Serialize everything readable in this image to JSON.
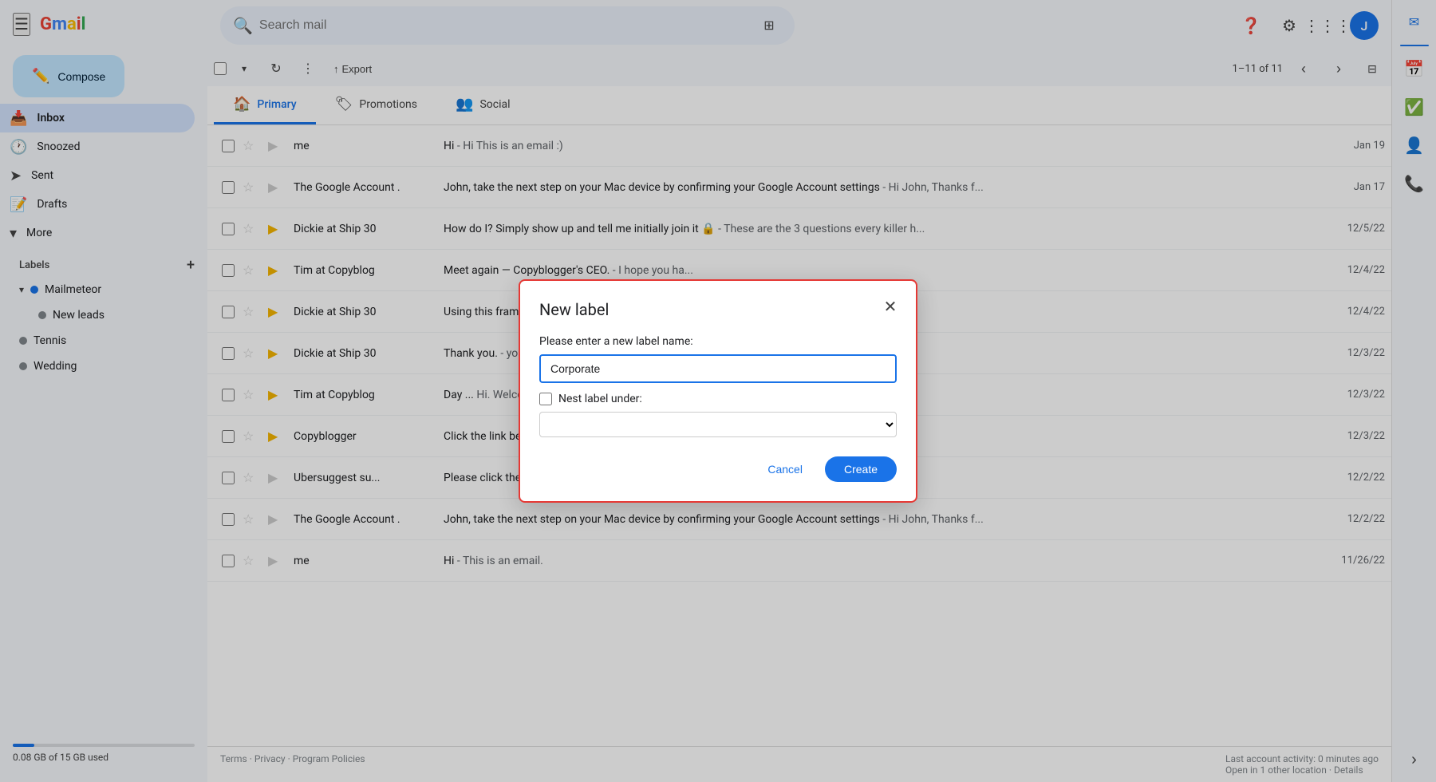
{
  "sidebar": {
    "hamburger_label": "☰",
    "logo_letters": [
      "G",
      "m",
      "a",
      "i",
      "l"
    ],
    "logo_text": "Gmail",
    "compose_label": "Compose",
    "nav_items": [
      {
        "id": "inbox",
        "label": "Inbox",
        "icon": "📥",
        "active": true
      },
      {
        "id": "snoozed",
        "label": "Snoozed",
        "icon": "🕐",
        "active": false
      },
      {
        "id": "sent",
        "label": "Sent",
        "icon": "📤",
        "active": false
      },
      {
        "id": "drafts",
        "label": "Drafts",
        "icon": "📝",
        "active": false
      },
      {
        "id": "more",
        "label": "More",
        "icon": "▾",
        "active": false
      }
    ],
    "labels_heading": "Labels",
    "labels": [
      {
        "id": "mailmeteor",
        "label": "Mailmeteor",
        "color": "blue",
        "expanded": true
      },
      {
        "id": "new-leads",
        "label": "New leads",
        "color": "gray",
        "indent": true
      },
      {
        "id": "tennis",
        "label": "Tennis",
        "color": "gray"
      },
      {
        "id": "wedding",
        "label": "Wedding",
        "color": "gray"
      }
    ],
    "storage_text": "0.08 GB of 15 GB used"
  },
  "topbar": {
    "search_placeholder": "Search mail",
    "icons": [
      "❓",
      "⚙",
      "⋮⋮⋮"
    ]
  },
  "toolbar": {
    "export_label": "Export",
    "count_text": "1–11 of 11"
  },
  "tabs": [
    {
      "id": "primary",
      "label": "Primary",
      "icon": "🏠",
      "active": true
    },
    {
      "id": "promotions",
      "label": "Promotions",
      "icon": "🏷",
      "active": false
    },
    {
      "id": "social",
      "label": "Social",
      "icon": "👥",
      "active": false
    }
  ],
  "emails": [
    {
      "sender": "me",
      "subject": "Hi",
      "preview": "Hi This is an email :)",
      "date": "Jan 19",
      "unread": false,
      "important": false
    },
    {
      "sender": "The Google Account .",
      "subject": "John, take the next step on your Mac device by confirming your Google Account settings",
      "preview": "Hi John, Thanks f...",
      "date": "Jan 17",
      "unread": false,
      "important": false
    },
    {
      "sender": "Dickie at Ship 30",
      "subject": "How do I? Simply show up and tell me initially join it",
      "preview": "These are the 3 questions every killer h...",
      "date": "12/5/22",
      "unread": false,
      "important": true
    },
    {
      "sender": "Tim at Copyblog",
      "subject": "Meet again — Copyblogger's CEO.",
      "preview": "I hope you ha...",
      "date": "12/4/22",
      "unread": false,
      "important": true
    },
    {
      "sender": "Dickie at Ship 30",
      "subject": "Using this framework, you'll never stare at a blank p...",
      "preview": "",
      "date": "12/4/22",
      "unread": false,
      "important": true
    },
    {
      "sender": "Dickie at Ship 30",
      "subject": "Thank you.",
      "preview": "",
      "date": "12/3/22",
      "unread": false,
      "important": true
    },
    {
      "sender": "Tim at Copyblog",
      "subject": "Day ... Hi. Welcome to the Copyblogger famil...",
      "preview": "",
      "date": "12/3/22",
      "unread": false,
      "important": true
    },
    {
      "sender": "Copyblogger",
      "subject": "Click the link below to confirm your subscriptio...",
      "preview": "",
      "date": "12/3/22",
      "unread": false,
      "important": true
    },
    {
      "sender": "Ubersuggest su...",
      "subject": "Please click the link below to confirm your accou...",
      "preview": "",
      "date": "12/2/22",
      "unread": false,
      "important": false
    },
    {
      "sender": "The Google Account .",
      "subject": "John, take the next step on your Mac device by confirming your Google Account settings",
      "preview": "Hi John, Thanks f...",
      "date": "12/2/22",
      "unread": false,
      "important": false
    },
    {
      "sender": "me",
      "subject": "Hi",
      "preview": "This is an email.",
      "date": "11/26/22",
      "unread": false,
      "important": false
    }
  ],
  "footer": {
    "terms": "Terms",
    "privacy": "Privacy",
    "program_policies": "Program Policies",
    "activity": "Last account activity: 0 minutes ago",
    "location": "Open in 1 other location · Details"
  },
  "modal": {
    "title": "New label",
    "label_prompt": "Please enter a new label name:",
    "input_value": "Corporate",
    "nest_label_text": "Nest label under:",
    "cancel_label": "Cancel",
    "create_label": "Create"
  },
  "right_panel": {
    "icons": [
      "📅",
      "✅",
      "👤",
      "📞"
    ]
  }
}
